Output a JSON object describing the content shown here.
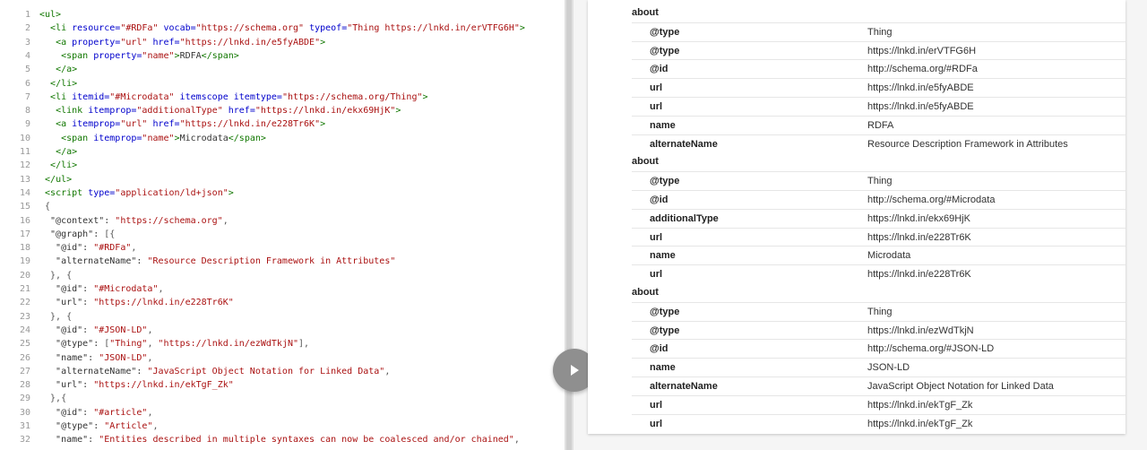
{
  "editor": {
    "lines": [
      {
        "n": "1",
        "segs": [
          [
            "tag",
            "<ul>"
          ]
        ]
      },
      {
        "n": "2",
        "segs": [
          [
            "src",
            "  "
          ],
          [
            "tag",
            "<li"
          ],
          [
            "attr",
            " resource="
          ],
          [
            "str",
            "\"#RDFa\""
          ],
          [
            "attr",
            " vocab="
          ],
          [
            "str",
            "\"https://schema.org\""
          ],
          [
            "attr",
            " typeof="
          ],
          [
            "str",
            "\"Thing https://lnkd.in/erVTFG6H\""
          ],
          [
            "tag",
            ">"
          ]
        ]
      },
      {
        "n": "3",
        "segs": [
          [
            "src",
            "   "
          ],
          [
            "tag",
            "<a"
          ],
          [
            "attr",
            " property="
          ],
          [
            "str",
            "\"url\""
          ],
          [
            "attr",
            " href="
          ],
          [
            "str",
            "\"https://lnkd.in/e5fyABDE\""
          ],
          [
            "tag",
            ">"
          ]
        ]
      },
      {
        "n": "4",
        "segs": [
          [
            "src",
            "    "
          ],
          [
            "tag",
            "<span"
          ],
          [
            "attr",
            " property="
          ],
          [
            "str",
            "\"name\""
          ],
          [
            "tag",
            ">"
          ],
          [
            "src",
            "RDFA"
          ],
          [
            "tag",
            "</span>"
          ]
        ]
      },
      {
        "n": "5",
        "segs": [
          [
            "src",
            "   "
          ],
          [
            "tag",
            "</a>"
          ]
        ]
      },
      {
        "n": "6",
        "segs": [
          [
            "src",
            "  "
          ],
          [
            "tag",
            "</li>"
          ]
        ]
      },
      {
        "n": "7",
        "segs": [
          [
            "src",
            "  "
          ],
          [
            "tag",
            "<li"
          ],
          [
            "attr",
            " itemid="
          ],
          [
            "str",
            "\"#Microdata\""
          ],
          [
            "attr",
            " itemscope itemtype="
          ],
          [
            "str",
            "\"https://schema.org/Thing\""
          ],
          [
            "tag",
            ">"
          ]
        ]
      },
      {
        "n": "8",
        "segs": [
          [
            "src",
            "   "
          ],
          [
            "tag",
            "<link"
          ],
          [
            "attr",
            " itemprop="
          ],
          [
            "str",
            "\"additionalType\""
          ],
          [
            "attr",
            " href="
          ],
          [
            "str",
            "\"https://lnkd.in/ekx69HjK\""
          ],
          [
            "tag",
            ">"
          ]
        ]
      },
      {
        "n": "9",
        "segs": [
          [
            "src",
            "   "
          ],
          [
            "tag",
            "<a"
          ],
          [
            "attr",
            " itemprop="
          ],
          [
            "str",
            "\"url\""
          ],
          [
            "attr",
            " href="
          ],
          [
            "str",
            "\"https://lnkd.in/e228Tr6K\""
          ],
          [
            "tag",
            ">"
          ]
        ]
      },
      {
        "n": "10",
        "segs": [
          [
            "src",
            "    "
          ],
          [
            "tag",
            "<span"
          ],
          [
            "attr",
            " itemprop="
          ],
          [
            "str",
            "\"name\""
          ],
          [
            "tag",
            ">"
          ],
          [
            "src",
            "Microdata"
          ],
          [
            "tag",
            "</span>"
          ]
        ]
      },
      {
        "n": "11",
        "segs": [
          [
            "src",
            "   "
          ],
          [
            "tag",
            "</a>"
          ]
        ]
      },
      {
        "n": "12",
        "segs": [
          [
            "src",
            "  "
          ],
          [
            "tag",
            "</li>"
          ]
        ]
      },
      {
        "n": "13",
        "segs": [
          [
            "src",
            " "
          ],
          [
            "tag",
            "</ul>"
          ]
        ]
      },
      {
        "n": "14",
        "segs": [
          [
            "src",
            " "
          ],
          [
            "tag",
            "<script"
          ],
          [
            "attr",
            " type="
          ],
          [
            "str",
            "\"application/ld+json\""
          ],
          [
            "tag",
            ">"
          ]
        ]
      },
      {
        "n": "15",
        "segs": [
          [
            "punc",
            " {"
          ]
        ]
      },
      {
        "n": "16",
        "segs": [
          [
            "key",
            "  \"@context\": "
          ],
          [
            "str",
            "\"https://schema.org\""
          ],
          [
            "punc",
            ","
          ]
        ]
      },
      {
        "n": "17",
        "segs": [
          [
            "key",
            "  \"@graph\": "
          ],
          [
            "punc",
            "[{"
          ]
        ]
      },
      {
        "n": "18",
        "segs": [
          [
            "key",
            "   \"@id\": "
          ],
          [
            "str",
            "\"#RDFa\""
          ],
          [
            "punc",
            ","
          ]
        ]
      },
      {
        "n": "19",
        "segs": [
          [
            "key",
            "   \"alternateName\": "
          ],
          [
            "str",
            "\"Resource Description Framework in Attributes\""
          ]
        ]
      },
      {
        "n": "20",
        "segs": [
          [
            "punc",
            "  }, {"
          ]
        ]
      },
      {
        "n": "21",
        "segs": [
          [
            "key",
            "   \"@id\": "
          ],
          [
            "str",
            "\"#Microdata\""
          ],
          [
            "punc",
            ","
          ]
        ]
      },
      {
        "n": "22",
        "segs": [
          [
            "key",
            "   \"url\": "
          ],
          [
            "str",
            "\"https://lnkd.in/e228Tr6K\""
          ]
        ]
      },
      {
        "n": "23",
        "segs": [
          [
            "punc",
            "  }, {"
          ]
        ]
      },
      {
        "n": "24",
        "segs": [
          [
            "key",
            "   \"@id\": "
          ],
          [
            "str",
            "\"#JSON-LD\""
          ],
          [
            "punc",
            ","
          ]
        ]
      },
      {
        "n": "25",
        "segs": [
          [
            "key",
            "   \"@type\": "
          ],
          [
            "punc",
            "["
          ],
          [
            "str",
            "\"Thing\""
          ],
          [
            "punc",
            ", "
          ],
          [
            "str",
            "\"https://lnkd.in/ezWdTkjN\""
          ],
          [
            "punc",
            "],"
          ]
        ]
      },
      {
        "n": "26",
        "segs": [
          [
            "key",
            "   \"name\": "
          ],
          [
            "str",
            "\"JSON-LD\""
          ],
          [
            "punc",
            ","
          ]
        ]
      },
      {
        "n": "27",
        "segs": [
          [
            "key",
            "   \"alternateName\": "
          ],
          [
            "str",
            "\"JavaScript Object Notation for Linked Data\""
          ],
          [
            "punc",
            ","
          ]
        ]
      },
      {
        "n": "28",
        "segs": [
          [
            "key",
            "   \"url\": "
          ],
          [
            "str",
            "\"https://lnkd.in/ekTgF_Zk\""
          ]
        ]
      },
      {
        "n": "29",
        "segs": [
          [
            "punc",
            "  },{"
          ]
        ]
      },
      {
        "n": "30",
        "segs": [
          [
            "key",
            "   \"@id\": "
          ],
          [
            "str",
            "\"#article\""
          ],
          [
            "punc",
            ","
          ]
        ]
      },
      {
        "n": "31",
        "segs": [
          [
            "key",
            "   \"@type\": "
          ],
          [
            "str",
            "\"Article\""
          ],
          [
            "punc",
            ","
          ]
        ]
      },
      {
        "n": "32",
        "segs": [
          [
            "key",
            "   \"name\": "
          ],
          [
            "str",
            "\"Entities described in multiple syntaxes can now be coalesced and/or chained\""
          ],
          [
            "punc",
            ","
          ]
        ]
      }
    ]
  },
  "results": {
    "rows": [
      {
        "kind": "head",
        "k": "about",
        "v": ""
      },
      {
        "kind": "prop",
        "k": "@type",
        "v": "Thing"
      },
      {
        "kind": "prop",
        "k": "@type",
        "v": "https://lnkd.in/erVTFG6H"
      },
      {
        "kind": "prop",
        "k": "@id",
        "v": "http://schema.org/#RDFa"
      },
      {
        "kind": "prop",
        "k": "url",
        "v": "https://lnkd.in/e5fyABDE"
      },
      {
        "kind": "prop",
        "k": "url",
        "v": "https://lnkd.in/e5fyABDE"
      },
      {
        "kind": "prop",
        "k": "name",
        "v": "RDFA"
      },
      {
        "kind": "prop",
        "k": "alternateName",
        "v": "Resource Description Framework in Attributes"
      },
      {
        "kind": "head",
        "k": "about",
        "v": ""
      },
      {
        "kind": "prop",
        "k": "@type",
        "v": "Thing"
      },
      {
        "kind": "prop",
        "k": "@id",
        "v": "http://schema.org/#Microdata"
      },
      {
        "kind": "prop",
        "k": "additionalType",
        "v": "https://lnkd.in/ekx69HjK"
      },
      {
        "kind": "prop",
        "k": "url",
        "v": "https://lnkd.in/e228Tr6K"
      },
      {
        "kind": "prop",
        "k": "name",
        "v": "Microdata"
      },
      {
        "kind": "prop",
        "k": "url",
        "v": "https://lnkd.in/e228Tr6K"
      },
      {
        "kind": "head",
        "k": "about",
        "v": ""
      },
      {
        "kind": "prop",
        "k": "@type",
        "v": "Thing"
      },
      {
        "kind": "prop",
        "k": "@type",
        "v": "https://lnkd.in/ezWdTkjN"
      },
      {
        "kind": "prop",
        "k": "@id",
        "v": "http://schema.org/#JSON-LD"
      },
      {
        "kind": "prop",
        "k": "name",
        "v": "JSON-LD"
      },
      {
        "kind": "prop",
        "k": "alternateName",
        "v": "JavaScript Object Notation for Linked Data"
      },
      {
        "kind": "prop",
        "k": "url",
        "v": "https://lnkd.in/ekTgF_Zk"
      },
      {
        "kind": "prop",
        "k": "url",
        "v": "https://lnkd.in/ekTgF_Zk"
      }
    ]
  },
  "run_button": {
    "icon": "play-icon"
  }
}
